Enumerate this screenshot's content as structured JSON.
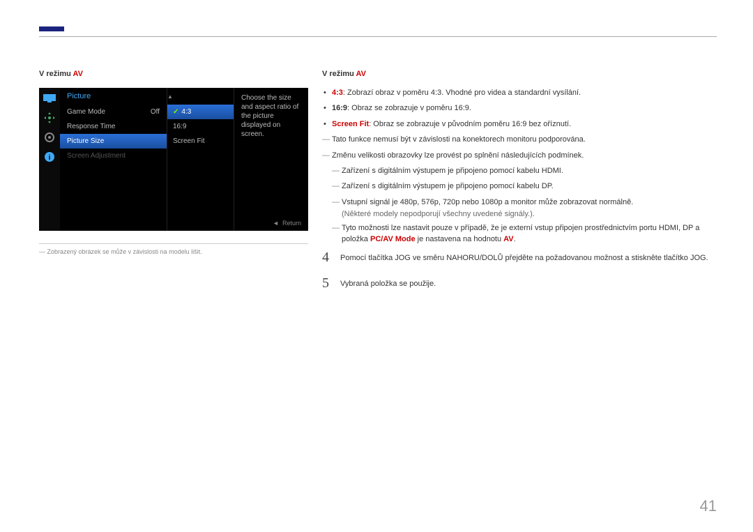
{
  "heading_prefix": "V režimu ",
  "heading_av": "AV",
  "osd": {
    "title": "Picture",
    "rows": [
      {
        "label": "Game Mode",
        "value": "Off"
      },
      {
        "label": "Response Time",
        "value": ""
      },
      {
        "label": "Picture Size",
        "value": ""
      },
      {
        "label": "Screen Adjustment",
        "value": ""
      }
    ],
    "opts": [
      "4:3",
      "16:9",
      "Screen Fit"
    ],
    "desc": "Choose the size and aspect ratio of the picture displayed on screen.",
    "return": "Return",
    "arrow_l": "◄",
    "arrow_u": "▲"
  },
  "left_note": "Zobrazený obrázek se může v závislosti na modelu lišit.",
  "bullets": [
    {
      "k": "4:3",
      "t": ": Zobrazí obraz v poměru 4:3. Vhodné pro videa a standardní vysílání."
    },
    {
      "k": "16:9",
      "t": ": Obraz se zobrazuje v poměru 16:9."
    },
    {
      "k": "Screen Fit",
      "t": ": Obraz se zobrazuje v původním poměru 16:9 bez oříznutí."
    }
  ],
  "dash1": "Tato funkce nemusí být v závislosti na konektorech monitoru podporována.",
  "dash2": "Změnu velikosti obrazovky lze provést po splnění následujících podmínek.",
  "sub": [
    "Zařízení s digitálním výstupem je připojeno pomocí kabelu HDMI.",
    "Zařízení s digitálním výstupem je připojeno pomocí kabelu DP.",
    "Vstupní signál je 480p, 576p, 720p nebo 1080p a monitor může zobrazovat normálně."
  ],
  "sub_extra": "(Některé modely nepodporují všechny uvedené signály.).",
  "sub4a": "Tyto možnosti lze nastavit pouze v případě, že je externí vstup připojen prostřednictvím portu HDMI, DP a položka ",
  "sub4b": "PC/AV Mode",
  "sub4c": " je nastavena na hodnotu ",
  "sub4d": "AV",
  "sub4e": ".",
  "steps": [
    {
      "n": "4",
      "t": "Pomocí tlačítka JOG ve směru NAHORU/DOLŮ přejděte na požadovanou možnost a stiskněte tlačítko JOG."
    },
    {
      "n": "5",
      "t": "Vybraná položka se použije."
    }
  ],
  "page": "41"
}
